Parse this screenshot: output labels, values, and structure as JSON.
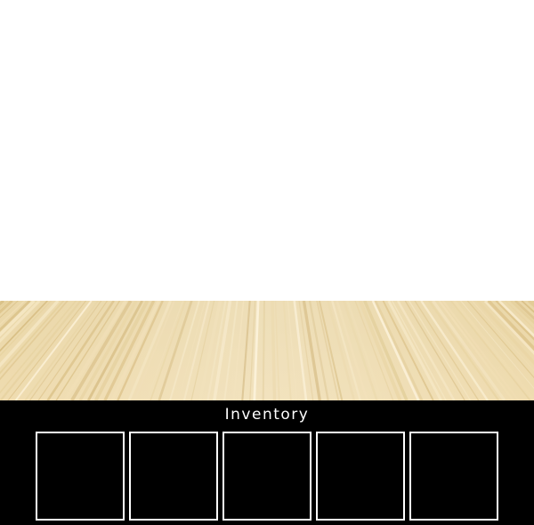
{
  "inventory": {
    "title": "Inventory",
    "slots": [
      {
        "item": null
      },
      {
        "item": null
      },
      {
        "item": null
      },
      {
        "item": null
      },
      {
        "item": null
      }
    ]
  },
  "colors": {
    "wall": "#ffffff",
    "floor_light": "#f3e3bd",
    "floor_dark": "#d8bf86",
    "panel": "#000000",
    "slot_border": "#ffffff",
    "text": "#ffffff"
  }
}
